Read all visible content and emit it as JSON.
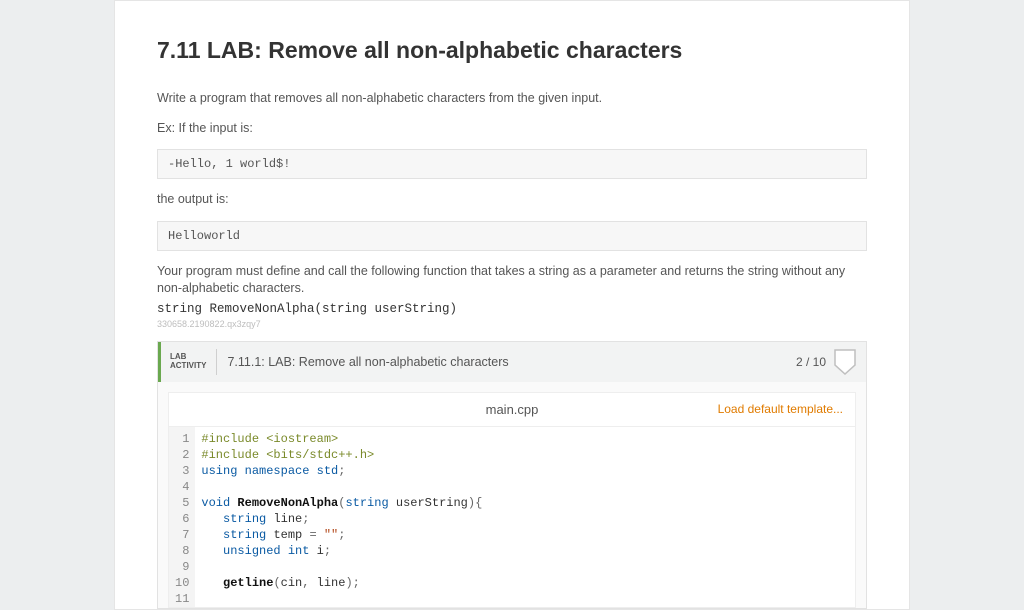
{
  "title": "7.11 LAB: Remove all non-alphabetic characters",
  "intro": "Write a program that removes all non-alphabetic characters from the given input.",
  "ex_label": "Ex: If the input is:",
  "input_sample": "-Hello, 1 world$!",
  "output_label": "the output is:",
  "output_sample": "Helloworld",
  "requirement": "Your program must define and call the following function that takes a string as a parameter and returns the string without any non-alphabetic characters.",
  "signature": "string RemoveNonAlpha(string userString)",
  "tiny_id": "330658.2190822.qx3zqy7",
  "lab": {
    "badge_line1": "LAB",
    "badge_line2": "ACTIVITY",
    "title": "7.11.1: LAB: Remove all non-alphabetic characters",
    "score": "2 / 10"
  },
  "editor": {
    "filename": "main.cpp",
    "load_default": "Load default template...",
    "lines": [
      {
        "n": 1
      },
      {
        "n": 2
      },
      {
        "n": 3
      },
      {
        "n": 4
      },
      {
        "n": 5
      },
      {
        "n": 6
      },
      {
        "n": 7
      },
      {
        "n": 8
      },
      {
        "n": 9
      },
      {
        "n": 10
      },
      {
        "n": 11
      }
    ],
    "code_raw": "#include <iostream>\n#include <bits/stdc++.h>\nusing namespace std;\n\nvoid RemoveNonAlpha(string userString){\n   string line;\n   string temp = \"\";\n   unsigned int i;\n\n   getline(cin, line);\n"
  }
}
